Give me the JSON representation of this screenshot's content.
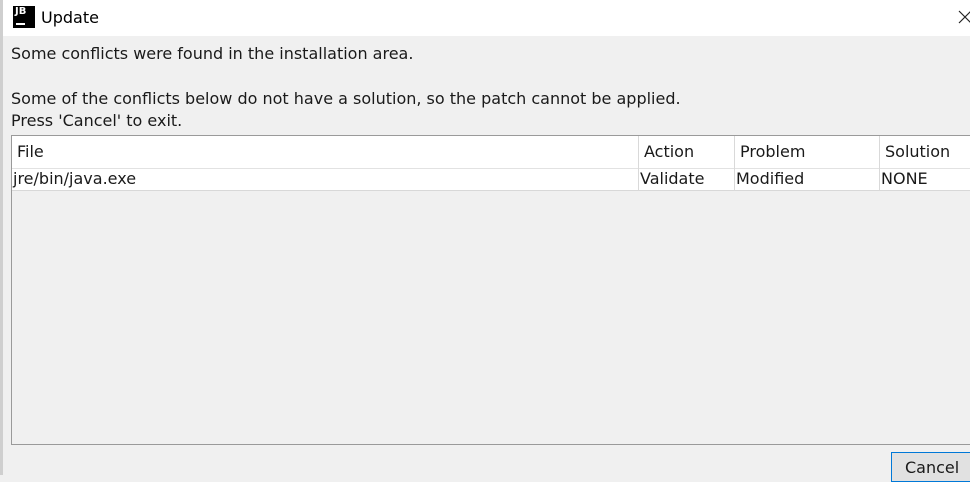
{
  "window": {
    "title": "Update",
    "icon": "jetbrains-logo-icon",
    "icon_text": "JB"
  },
  "messages": {
    "line1": "Some conflicts were found in the installation area.",
    "line2": "Some of the conflicts below do not have a solution, so the patch cannot be applied.",
    "line3": "Press 'Cancel' to exit."
  },
  "table": {
    "headers": [
      "File",
      "Action",
      "Problem",
      "Solution"
    ],
    "rows": [
      [
        "jre/bin/java.exe",
        "Validate",
        "Modified",
        "NONE"
      ]
    ]
  },
  "buttons": {
    "cancel_label": "Cancel"
  },
  "colors": {
    "dialog_bg": "#f0f0f0",
    "button_focus_border": "#0078d7"
  }
}
